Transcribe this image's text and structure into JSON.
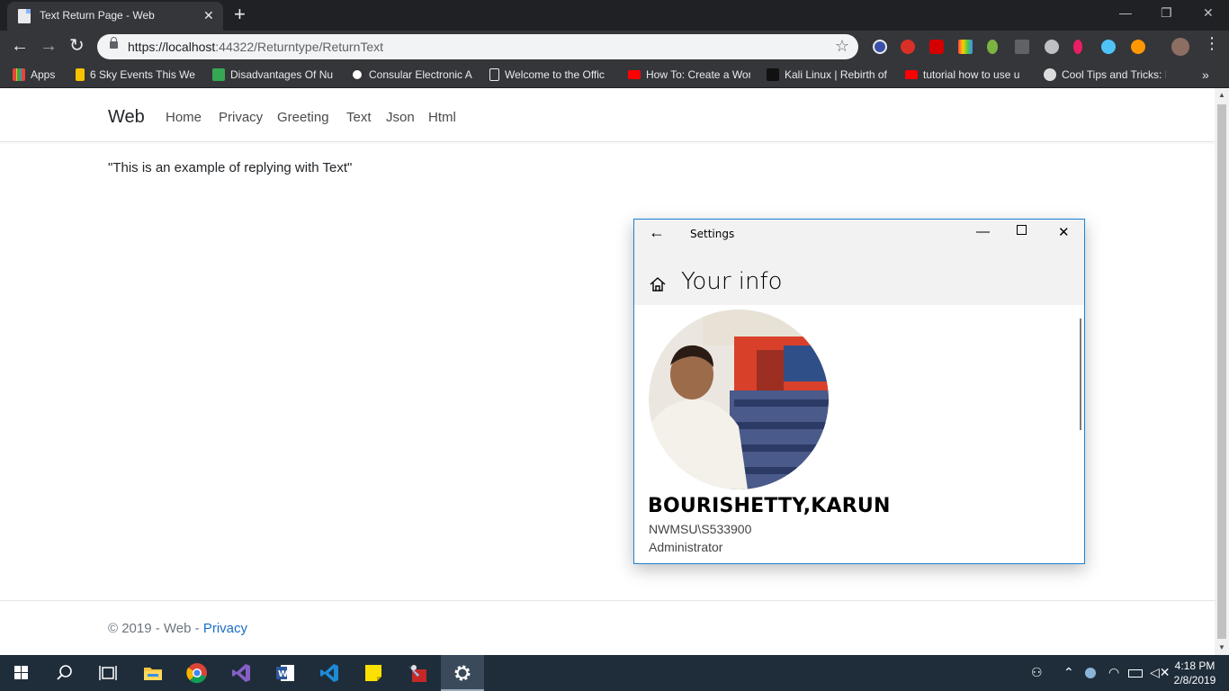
{
  "browser": {
    "tab_title": "Text Return Page - Web",
    "tab_close": "✕",
    "new_tab": "+",
    "url_host": "https://localhost",
    "url_rest": ":44322/Returntype/ReturnText",
    "bookmarks": [
      {
        "label": "Apps",
        "color": "#ea4335"
      },
      {
        "label": "6 Sky Events This We",
        "color": "#f9c200"
      },
      {
        "label": "Disadvantages Of Nu",
        "color": "#34a853"
      },
      {
        "label": "Consular Electronic A",
        "color": "#ffffff"
      },
      {
        "label": "Welcome to the Offic",
        "color": "#cccccc"
      },
      {
        "label": "How To: Create a Wor",
        "color": "#ff0000"
      },
      {
        "label": "Kali Linux | Rebirth of",
        "color": "#111111"
      },
      {
        "label": "tutorial how to use u",
        "color": "#ff0000"
      },
      {
        "label": "Cool Tips and Tricks: I",
        "color": "#dddddd"
      }
    ],
    "bookmarks_more": "»"
  },
  "site": {
    "brand": "Web",
    "nav": [
      "Home",
      "Privacy",
      "Greeting",
      "Text",
      "Json",
      "Html"
    ],
    "body_text": "\"This is an example of replying with Text\"",
    "footer_prefix": "© 2019 - Web - ",
    "footer_link": "Privacy",
    "link_color": "#1b6ec2"
  },
  "settings_window": {
    "title": "Settings",
    "page_title": "Your info",
    "user_name": "BOURISHETTY,KARUN",
    "account": "NWMSU\\S533900",
    "role": "Administrator",
    "accent": "#1883d7"
  },
  "taskbar": {
    "time": "4:18 PM",
    "date": "2/8/2019",
    "icons": [
      "file-explorer-icon",
      "chrome-icon",
      "visual-studio-icon",
      "word-icon",
      "vscode-icon",
      "sticky-notes-icon",
      "paint-icon",
      "settings-gear-icon"
    ]
  }
}
